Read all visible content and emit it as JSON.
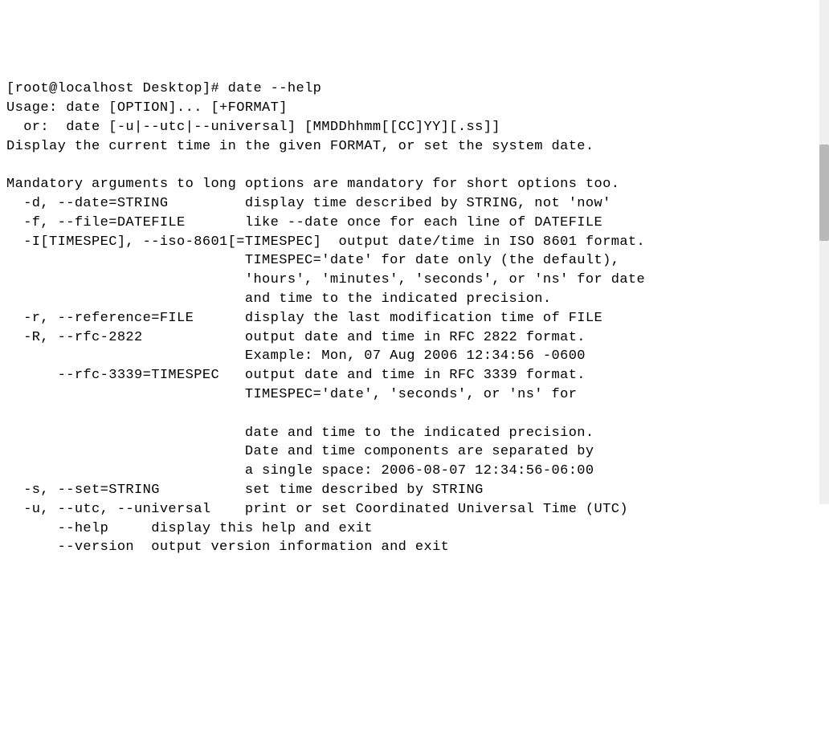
{
  "prompt": "[root@localhost Desktop]# ",
  "command": "date --help",
  "lines": {
    "usage1": "Usage: date [OPTION]... [+FORMAT]",
    "usage2": "  or:  date [-u|--utc|--universal] [MMDDhhmm[[CC]YY][.ss]]",
    "desc": "Display the current time in the given FORMAT, or set the system date.",
    "blank1": "",
    "mandatory": "Mandatory arguments to long options are mandatory for short options too.",
    "opt_d": "  -d, --date=STRING         display time described by STRING, not 'now'",
    "opt_f": "  -f, --file=DATEFILE       like --date once for each line of DATEFILE",
    "opt_I1": "  -I[TIMESPEC], --iso-8601[=TIMESPEC]  output date/time in ISO 8601 format.",
    "opt_I2": "                            TIMESPEC='date' for date only (the default),",
    "opt_I3": "                            'hours', 'minutes', 'seconds', or 'ns' for date",
    "opt_I4": "                            and time to the indicated precision.",
    "opt_r": "  -r, --reference=FILE      display the last modification time of FILE",
    "opt_R1": "  -R, --rfc-2822            output date and time in RFC 2822 format.",
    "opt_R2": "                            Example: Mon, 07 Aug 2006 12:34:56 -0600",
    "opt_rfc1": "      --rfc-3339=TIMESPEC   output date and time in RFC 3339 format.",
    "opt_rfc2": "                            TIMESPEC='date', 'seconds', or 'ns' for",
    "opt_rfc3": "                            date and time to the indicated precision.",
    "opt_rfc4": "                            Date and time components are separated by",
    "opt_rfc5": "                            a single space: 2006-08-07 12:34:56-06:00",
    "opt_s": "  -s, --set=STRING          set time described by STRING",
    "opt_u": "  -u, --utc, --universal    print or set Coordinated Universal Time (UTC)",
    "opt_help": "      --help     display this help and exit",
    "opt_ver": "      --version  output version information and exit"
  },
  "watermark": ""
}
